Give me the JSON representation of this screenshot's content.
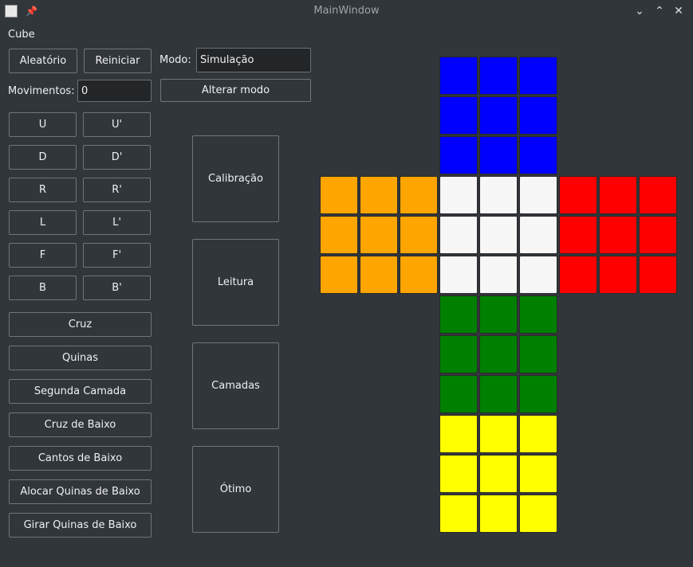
{
  "window": {
    "title": "MainWindow"
  },
  "menu": {
    "label": "Cube"
  },
  "controls": {
    "random_label": "Aleatório",
    "restart_label": "Reiniciar",
    "mode_label": "Modo:",
    "mode_value": "Simulação",
    "moves_label": "Movimentos:",
    "moves_value": "0",
    "change_mode_label": "Alterar modo"
  },
  "moves": [
    "U",
    "U'",
    "D",
    "D'",
    "R",
    "R'",
    "L",
    "L'",
    "F",
    "F'",
    "B",
    "B'"
  ],
  "steps": [
    "Cruz",
    "Quinas",
    "Segunda Camada",
    "Cruz de Baixo",
    "Cantos de Baixo",
    "Alocar Quinas de Baixo",
    "Girar Quinas de Baixo"
  ],
  "panels": [
    "Calibração",
    "Leitura",
    "Camadas",
    "Ótimo"
  ],
  "cube": {
    "colors": {
      "blue": "#0000ff",
      "orange": "#ffa500",
      "white": "#f7f7f7",
      "red": "#ff0000",
      "green": "#008000",
      "yellow": "#ffff00"
    },
    "faces": [
      {
        "name": "top",
        "color": "blue"
      },
      {
        "name": "left",
        "color": "orange"
      },
      {
        "name": "front",
        "color": "white"
      },
      {
        "name": "right",
        "color": "red"
      },
      {
        "name": "bottom",
        "color": "green"
      },
      {
        "name": "back",
        "color": "yellow"
      }
    ]
  }
}
